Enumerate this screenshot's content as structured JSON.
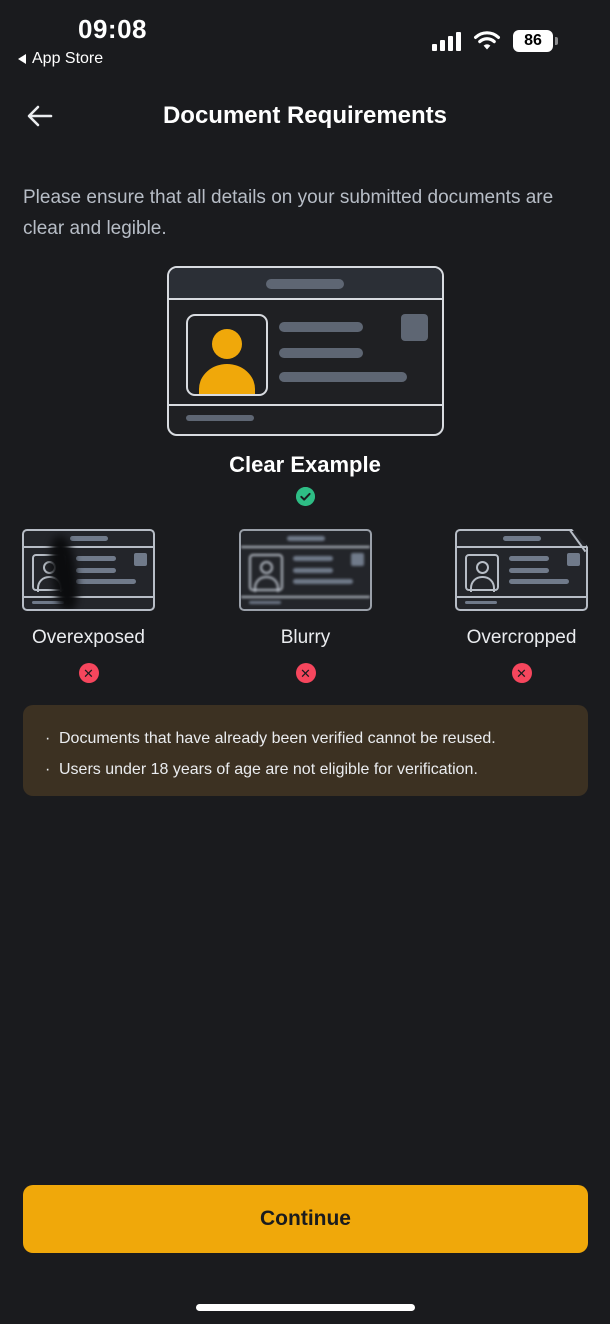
{
  "status_bar": {
    "time": "09:08",
    "back_app_label": "App Store",
    "battery_level": "86"
  },
  "header": {
    "title": "Document Requirements",
    "back_icon": "arrow-left-icon"
  },
  "intro_text": "Please ensure that all details on your submitted documents are clear and legible.",
  "clear_example": {
    "label": "Clear Example",
    "status_icon": "check-circle-icon"
  },
  "bad_examples": [
    {
      "label": "Overexposed",
      "status_icon": "x-circle-icon"
    },
    {
      "label": "Blurry",
      "status_icon": "x-circle-icon"
    },
    {
      "label": "Overcropped",
      "status_icon": "x-circle-icon"
    }
  ],
  "notice": {
    "items": [
      "Documents that have already been verified cannot be reused.",
      "Users under 18 years of age are not eligible for verification."
    ]
  },
  "continue_label": "Continue",
  "colors": {
    "background": "#1a1b1e",
    "accent": "#f0a80a",
    "success": "#2ebd85",
    "error": "#f6465d",
    "notice_bg": "#3c3122"
  }
}
